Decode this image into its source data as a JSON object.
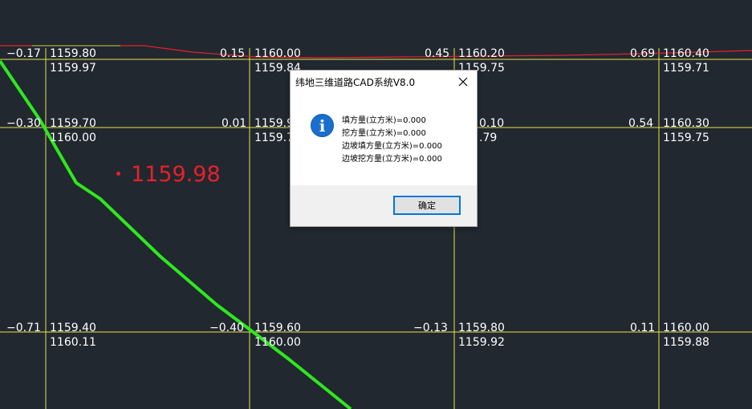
{
  "cad": {
    "red_label": "1159.98",
    "labels": {
      "r1_c0_left": "−0.17",
      "r1_c0_top": "1159.80",
      "r1_c0_bottom": "1159.97",
      "r1_c1_left": "0.15",
      "r1_c1_top": "1160.00",
      "r1_c1_bottom": "1159.84",
      "r1_c2_left": "0.45",
      "r1_c2_top": "1160.20",
      "r1_c2_bottom": "1159.75",
      "r1_c3_left": "0.69",
      "r1_c3_top": "1160.40",
      "r1_c3_bottom": "1159.71",
      "r2_c0_left": "−0.30",
      "r2_c0_top": "1159.70",
      "r2_c0_bottom": "1160.00",
      "r2_c1_left": "0.01",
      "r2_c1_top": "1159.9",
      "r2_c1_bottom": "1159.7",
      "r2_c2_top": "0.10",
      "r2_c2_bottom": ".79",
      "r2_c3_left": "0.54",
      "r2_c3_top": "1160.30",
      "r2_c3_bottom": "1159.75",
      "r3_c0_left": "−0.71",
      "r3_c0_top": "1159.40",
      "r3_c0_bottom": "1160.11",
      "r3_c1_left": "−0.40",
      "r3_c1_top": "1159.60",
      "r3_c1_bottom": "1160.00",
      "r3_c2_left": "−0.13",
      "r3_c2_top": "1159.80",
      "r3_c2_bottom": "1159.92",
      "r3_c3_left": "0.11",
      "r3_c3_top": "1160.00",
      "r3_c3_bottom": "1159.88"
    },
    "colors": {
      "background": "#212830",
      "grid": "#e8e24a",
      "terrain_line": "#2ee81e",
      "red": "#e8202a"
    }
  },
  "dialog": {
    "title": "纬地三维道路CAD系统V8.0",
    "icon": "info-icon",
    "messages": [
      "填方量(立方米)=0.000",
      "挖方量(立方米)=0.000",
      "边坡填方量(立方米)=0.000",
      "边坡挖方量(立方米)=0.000"
    ],
    "ok_label": "确定",
    "close_icon": "close-icon"
  }
}
